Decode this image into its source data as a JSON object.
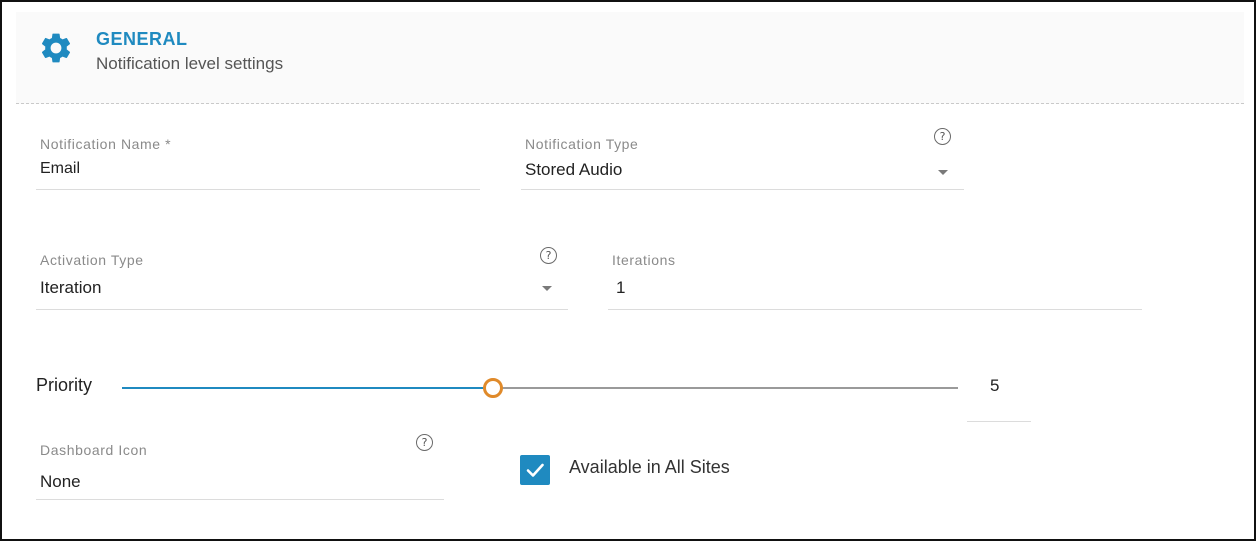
{
  "header": {
    "title": "GENERAL",
    "subtitle": "Notification level settings",
    "icon": "gear-icon"
  },
  "fields": {
    "notification_name": {
      "label": "Notification Name *",
      "value": "Email"
    },
    "notification_type": {
      "label": "Notification Type",
      "value": "Stored Audio"
    },
    "activation_type": {
      "label": "Activation Type",
      "value": "Iteration"
    },
    "iterations": {
      "label": "Iterations",
      "value": "1"
    },
    "dashboard_icon": {
      "label": "Dashboard Icon",
      "value": "None"
    }
  },
  "help_glyph": "?",
  "priority": {
    "label": "Priority",
    "value": "5",
    "level_fraction": 0.39
  },
  "available_all_sites": {
    "label": "Available in All Sites",
    "checked": true
  },
  "colors": {
    "accent": "#1f8ac0",
    "slider_thumb": "#e08a2a",
    "border": "#111111"
  }
}
